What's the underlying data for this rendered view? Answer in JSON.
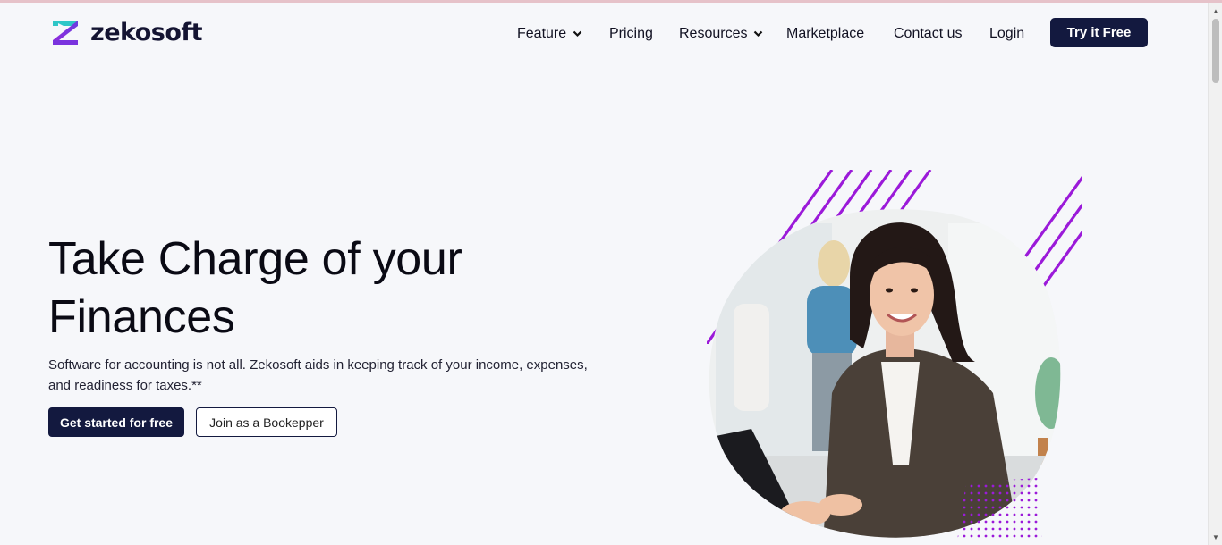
{
  "brand": {
    "name": "zekosoft",
    "logo_icon": "zekosoft-z-logo-icon",
    "colors": {
      "primary": "#13193f",
      "accent_purple": "#9b1ad9",
      "logo_teal": "#2fc6c7"
    }
  },
  "nav": {
    "items": [
      {
        "label": "Feature",
        "has_dropdown": true
      },
      {
        "label": "Pricing",
        "has_dropdown": false
      },
      {
        "label": "Resources",
        "has_dropdown": true
      },
      {
        "label": "Marketplace",
        "has_dropdown": false
      },
      {
        "label": "Contact us",
        "has_dropdown": false
      },
      {
        "label": "Login",
        "has_dropdown": false
      }
    ],
    "cta_label": "Try it Free"
  },
  "hero": {
    "title_line1": "Take Charge of your",
    "title_line2": "Finances",
    "subtitle": "Software for accounting is not all. Zekosoft aids in keeping track of your income, expenses, and readiness for taxes.**",
    "primary_button": "Get started for free",
    "secondary_button": "Join as a Bookepper",
    "image_icon": "smiling-businesswoman-at-laptop-photo"
  }
}
